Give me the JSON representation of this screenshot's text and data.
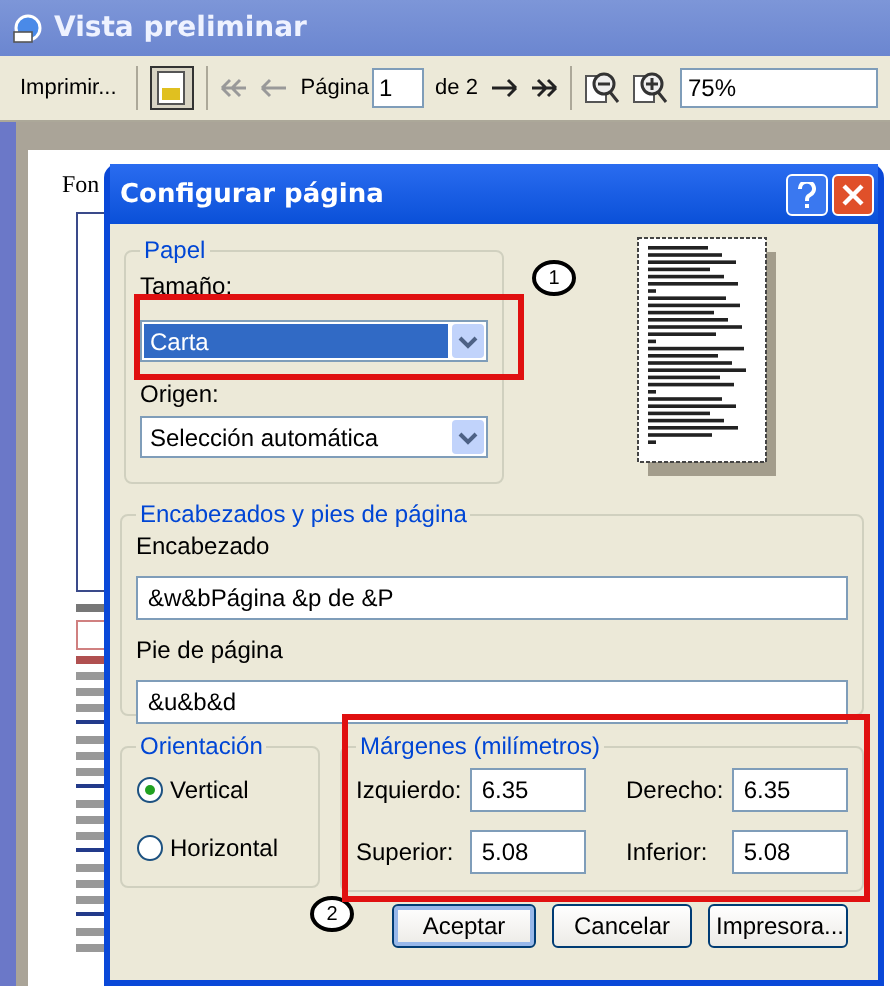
{
  "window": {
    "title": "Vista preliminar"
  },
  "toolbar": {
    "print_label": "Imprimir...",
    "page_label": "Página",
    "page_value": "1",
    "page_total": "de 2",
    "zoom_value": "75%"
  },
  "preview": {
    "heading": "Fon"
  },
  "dialog": {
    "title": "Configurar página",
    "paper": {
      "legend": "Papel",
      "size_label": "Tamaño:",
      "size_value": "Carta",
      "size_highlighted": true,
      "source_label": "Origen:",
      "source_value": "Selección automática"
    },
    "headers": {
      "legend": "Encabezados y pies de página",
      "header_label": "Encabezado",
      "header_value": "&w&bPágina &p de &P",
      "footer_label": "Pie de página",
      "footer_value": "&u&b&d"
    },
    "orientation": {
      "legend": "Orientación",
      "options": [
        {
          "label": "Vertical",
          "selected": true
        },
        {
          "label": "Horizontal",
          "selected": false
        }
      ]
    },
    "margins": {
      "legend": "Márgenes (milímetros)",
      "fields": [
        {
          "label": "Izquierdo:",
          "value": "6.35"
        },
        {
          "label": "Derecho:",
          "value": "6.35"
        },
        {
          "label": "Superior:",
          "value": "5.08"
        },
        {
          "label": "Inferior:",
          "value": "5.08"
        }
      ]
    },
    "buttons": [
      {
        "label": "Aceptar",
        "default": true
      },
      {
        "label": "Cancelar",
        "default": false
      },
      {
        "label": "Impresora...",
        "default": false
      }
    ],
    "annotations": [
      {
        "label": "1"
      },
      {
        "label": "2"
      }
    ]
  }
}
